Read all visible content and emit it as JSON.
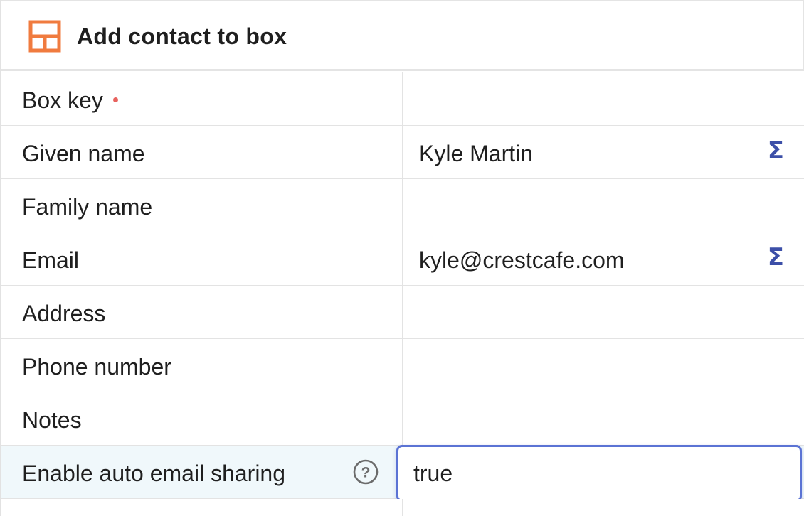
{
  "header": {
    "title": "Add contact to box",
    "icon": "layout-table-icon",
    "icon_color": "#f07b3f"
  },
  "fields": [
    {
      "label": "Box key",
      "required": true,
      "value": ""
    },
    {
      "label": "Given name",
      "value": "Kyle Martin",
      "formula_icon": "sigma-icon"
    },
    {
      "label": "Family name",
      "value": ""
    },
    {
      "label": "Email",
      "value": "kyle@crestcafe.com",
      "formula_icon": "sigma-icon"
    },
    {
      "label": "Address",
      "value": ""
    },
    {
      "label": "Phone number",
      "value": ""
    },
    {
      "label": "Notes",
      "value": ""
    },
    {
      "label": "Enable auto email sharing",
      "help_icon": "help-circle-icon",
      "value": "true",
      "focused": true
    }
  ],
  "sigma_glyph": "Σ",
  "colors": {
    "accent": "#3c4fa8",
    "focus_border": "#5b73d4",
    "required": "#e8625e",
    "highlight_row": "#f0f8fb"
  }
}
